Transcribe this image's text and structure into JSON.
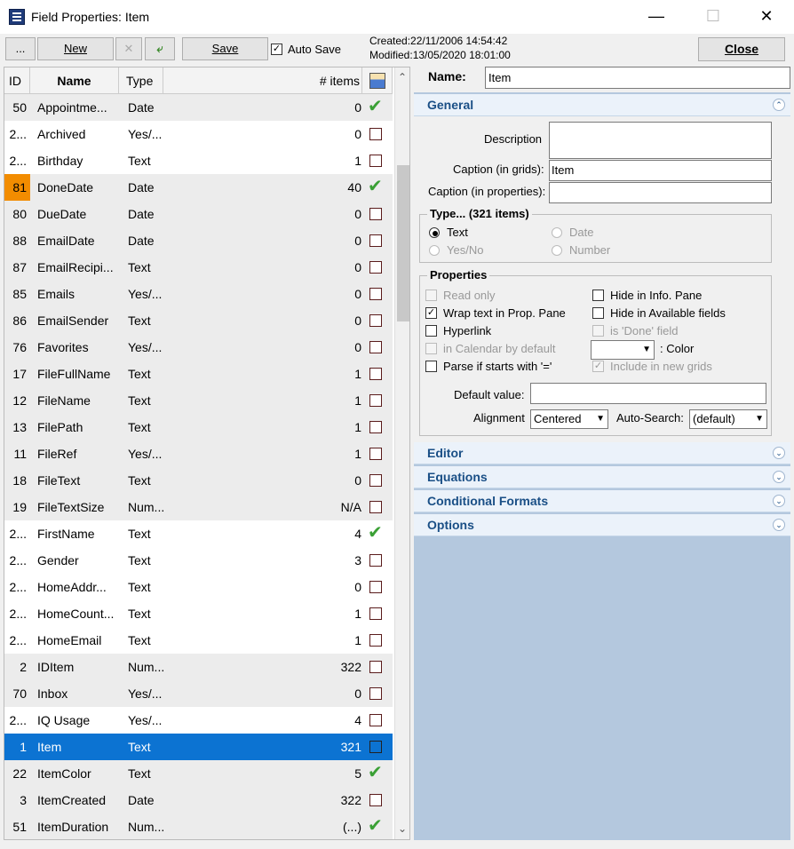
{
  "window": {
    "title": "Field Properties: Item"
  },
  "toolbar": {
    "menu_label": "...",
    "new_label": "New",
    "save_label": "Save",
    "autosave_label": "Auto Save",
    "autosave_checked": true,
    "close_label": "Close",
    "created": "Created:22/11/2006 14:54:42",
    "modified": "Modified:13/05/2020 18:01:00"
  },
  "grid": {
    "headers": {
      "id": "ID",
      "name": "Name",
      "type": "Type",
      "items": "# items"
    },
    "rows": [
      {
        "id": "50",
        "name": "Appointme...",
        "type": "Date",
        "items": "0",
        "flag": "tick"
      },
      {
        "id": "2...",
        "name": "Archived",
        "type": "Yes/...",
        "items": "0",
        "flag": "box"
      },
      {
        "id": "2...",
        "name": "Birthday",
        "type": "Text",
        "items": "1",
        "flag": "box"
      },
      {
        "id": "81",
        "name": "DoneDate",
        "type": "Date",
        "items": "40",
        "flag": "tick"
      },
      {
        "id": "80",
        "name": "DueDate",
        "type": "Date",
        "items": "0",
        "flag": "box"
      },
      {
        "id": "88",
        "name": "EmailDate",
        "type": "Date",
        "items": "0",
        "flag": "box"
      },
      {
        "id": "87",
        "name": "EmailRecipi...",
        "type": "Text",
        "items": "0",
        "flag": "box"
      },
      {
        "id": "85",
        "name": "Emails",
        "type": "Yes/...",
        "items": "0",
        "flag": "box"
      },
      {
        "id": "86",
        "name": "EmailSender",
        "type": "Text",
        "items": "0",
        "flag": "box"
      },
      {
        "id": "76",
        "name": "Favorites",
        "type": "Yes/...",
        "items": "0",
        "flag": "box"
      },
      {
        "id": "17",
        "name": "FileFullName",
        "type": "Text",
        "items": "1",
        "flag": "box"
      },
      {
        "id": "12",
        "name": "FileName",
        "type": "Text",
        "items": "1",
        "flag": "box"
      },
      {
        "id": "13",
        "name": "FilePath",
        "type": "Text",
        "items": "1",
        "flag": "box"
      },
      {
        "id": "11",
        "name": "FileRef",
        "type": "Yes/...",
        "items": "1",
        "flag": "box"
      },
      {
        "id": "18",
        "name": "FileText",
        "type": "Text",
        "items": "0",
        "flag": "box"
      },
      {
        "id": "19",
        "name": "FileTextSize",
        "type": "Num...",
        "items": "N/A",
        "flag": "box"
      },
      {
        "id": "2...",
        "name": "FirstName",
        "type": "Text",
        "items": "4",
        "flag": "tick"
      },
      {
        "id": "2...",
        "name": "Gender",
        "type": "Text",
        "items": "3",
        "flag": "box"
      },
      {
        "id": "2...",
        "name": "HomeAddr...",
        "type": "Text",
        "items": "0",
        "flag": "box"
      },
      {
        "id": "2...",
        "name": "HomeCount...",
        "type": "Text",
        "items": "1",
        "flag": "box"
      },
      {
        "id": "2...",
        "name": "HomeEmail",
        "type": "Text",
        "items": "1",
        "flag": "box"
      },
      {
        "id": "2",
        "name": "IDItem",
        "type": "Num...",
        "items": "322",
        "flag": "box"
      },
      {
        "id": "70",
        "name": "Inbox",
        "type": "Yes/...",
        "items": "0",
        "flag": "box"
      },
      {
        "id": "2...",
        "name": "IQ Usage",
        "type": "Yes/...",
        "items": "4",
        "flag": "box"
      },
      {
        "id": "1",
        "name": "Item",
        "type": "Text",
        "items": "321",
        "flag": "box",
        "selected": true
      },
      {
        "id": "22",
        "name": "ItemColor",
        "type": "Text",
        "items": "5",
        "flag": "tick"
      },
      {
        "id": "3",
        "name": "ItemCreated",
        "type": "Date",
        "items": "322",
        "flag": "box"
      },
      {
        "id": "51",
        "name": "ItemDuration",
        "type": "Num...",
        "items": "(...)",
        "flag": "tick"
      }
    ]
  },
  "properties": {
    "name_label": "Name:",
    "name_value": "Item",
    "sections": {
      "general": "General",
      "editor": "Editor",
      "equations": "Equations",
      "conditional_formats": "Conditional Formats",
      "options": "Options"
    },
    "general": {
      "description_label": "Description",
      "description_value": "",
      "caption_grids_label": "Caption (in grids):",
      "caption_grids_value": "Item",
      "caption_props_label": "Caption (in properties):",
      "caption_props_value": "",
      "type_title": "Type...  (321 items)",
      "type_options": {
        "text": "Text",
        "date": "Date",
        "yesno": "Yes/No",
        "number": "Number"
      },
      "properties_title": "Properties",
      "props": {
        "read_only": "Read only",
        "wrap_text": "Wrap text in Prop. Pane",
        "hyperlink": "Hyperlink",
        "in_calendar": "in Calendar by default",
        "parse_if": "Parse if starts with '='",
        "hide_info": "Hide in Info. Pane",
        "hide_available": "Hide in Available fields",
        "is_done": "is 'Done' field",
        "color_label": ": Color",
        "include_new": "Include in new grids"
      },
      "default_value_label": "Default value:",
      "default_value": "",
      "alignment_label": "Alignment",
      "alignment_value": "Centered",
      "autosearch_label": "Auto-Search:",
      "autosearch_value": "(default)"
    }
  },
  "colors": {
    "selection": "#0c73d2",
    "accent_cell": "#f28c00",
    "section_text": "#1a4f86",
    "panel_bg": "#b4c8de"
  },
  "icons": [
    "app-icon",
    "minimize-icon",
    "maximize-icon",
    "close-icon",
    "delete-icon",
    "back-arrow-icon",
    "column-chooser-icon",
    "tick-icon",
    "chevron-up-icon",
    "chevron-down-icon"
  ]
}
